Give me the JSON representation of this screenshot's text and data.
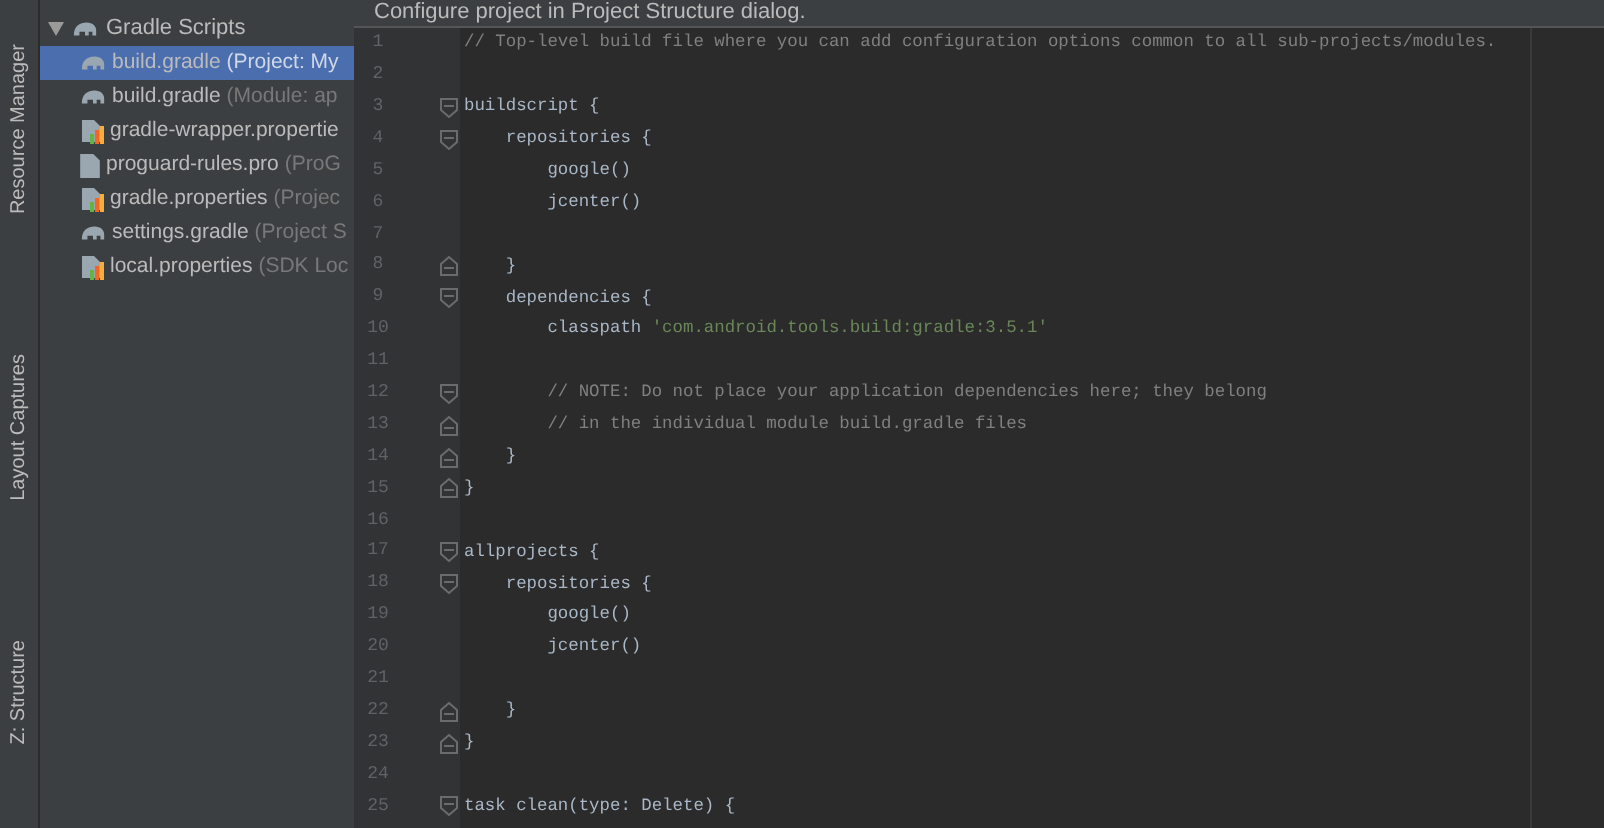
{
  "tool_strip": [
    {
      "label": "Resource Manager"
    },
    {
      "label": "Layout Captures"
    },
    {
      "label": "Z: Structure"
    }
  ],
  "project_tree": {
    "group": {
      "label": "Gradle Scripts",
      "expanded": true
    },
    "items": [
      {
        "kind": "gradle",
        "name": "build.gradle",
        "detail": "(Project: My",
        "selected": true
      },
      {
        "kind": "gradle",
        "name": "build.gradle",
        "detail": "(Module: ap",
        "selected": false
      },
      {
        "kind": "properties",
        "name": "gradle-wrapper.propertie",
        "selected": false
      },
      {
        "kind": "file",
        "name": "proguard-rules.pro",
        "detail": "(ProG",
        "selected": false
      },
      {
        "kind": "properties",
        "name": "gradle.properties",
        "detail": "(Projec",
        "selected": false
      },
      {
        "kind": "gradle",
        "name": "settings.gradle",
        "detail": "(Project S",
        "selected": false
      },
      {
        "kind": "properties",
        "name": "local.properties",
        "detail": "(SDK Loc",
        "selected": false
      }
    ]
  },
  "notification": "Configure project in Project Structure dialog.",
  "editor": {
    "lines": [
      {
        "number": "1",
        "kind": "plain",
        "segments": [
          {
            "kind": "comment",
            "text": "// Top-level build file where you can add configuration options common to all sub-projects/modules."
          }
        ]
      },
      {
        "number": "2",
        "kind": "plain"
      },
      {
        "number": "3",
        "kind": "fold_start",
        "segments": [
          {
            "kind": "plain",
            "text": "buildscript {"
          }
        ]
      },
      {
        "number": "4",
        "kind": "fold_start",
        "segments": [
          {
            "kind": "plain",
            "text": "    repositories {"
          }
        ]
      },
      {
        "number": "5",
        "kind": "plain",
        "segments": [
          {
            "kind": "plain",
            "text": "        google()"
          }
        ]
      },
      {
        "number": "6",
        "kind": "plain",
        "segments": [
          {
            "kind": "plain",
            "text": "        jcenter()"
          }
        ]
      },
      {
        "number": "7",
        "kind": "plain"
      },
      {
        "number": "8",
        "kind": "fold_end",
        "segments": [
          {
            "kind": "plain",
            "text": "    }"
          }
        ]
      },
      {
        "number": "9",
        "kind": "fold_start",
        "segments": [
          {
            "kind": "plain",
            "text": "    dependencies {"
          }
        ]
      },
      {
        "number": "10",
        "kind": "plain",
        "segments": [
          {
            "kind": "plain",
            "text": "        classpath "
          },
          {
            "kind": "string",
            "text": "'com.android.tools.build:gradle:3.5.1'"
          }
        ]
      },
      {
        "number": "11",
        "kind": "plain"
      },
      {
        "number": "12",
        "kind": "fold_start",
        "segments": [
          {
            "kind": "comment",
            "text": "        // NOTE: Do not place your application dependencies here; they belong"
          }
        ]
      },
      {
        "number": "13",
        "kind": "fold_end",
        "segments": [
          {
            "kind": "comment",
            "text": "        // in the individual module build.gradle files"
          }
        ]
      },
      {
        "number": "14",
        "kind": "fold_end",
        "segments": [
          {
            "kind": "plain",
            "text": "    }"
          }
        ]
      },
      {
        "number": "15",
        "kind": "fold_end",
        "segments": [
          {
            "kind": "plain",
            "text": "}"
          }
        ]
      },
      {
        "number": "16",
        "kind": "plain"
      },
      {
        "number": "17",
        "kind": "fold_start",
        "segments": [
          {
            "kind": "plain",
            "text": "allprojects {"
          }
        ]
      },
      {
        "number": "18",
        "kind": "fold_start",
        "segments": [
          {
            "kind": "plain",
            "text": "    repositories {"
          }
        ]
      },
      {
        "number": "19",
        "kind": "plain",
        "segments": [
          {
            "kind": "plain",
            "text": "        google()"
          }
        ]
      },
      {
        "number": "20",
        "kind": "plain",
        "segments": [
          {
            "kind": "plain",
            "text": "        jcenter()"
          }
        ]
      },
      {
        "number": "21",
        "kind": "plain"
      },
      {
        "number": "22",
        "kind": "fold_end",
        "segments": [
          {
            "kind": "plain",
            "text": "    }"
          }
        ]
      },
      {
        "number": "23",
        "kind": "fold_end",
        "segments": [
          {
            "kind": "plain",
            "text": "}"
          }
        ]
      },
      {
        "number": "24",
        "kind": "plain"
      },
      {
        "number": "25",
        "kind": "fold_start",
        "segments": [
          {
            "kind": "plain",
            "text": "task clean(type: Delete) {"
          }
        ]
      }
    ]
  }
}
